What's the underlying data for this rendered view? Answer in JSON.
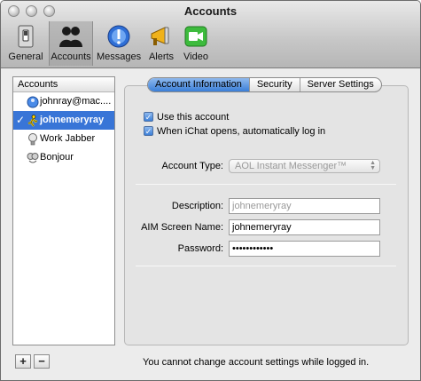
{
  "window": {
    "title": "Accounts"
  },
  "toolbar": {
    "items": [
      {
        "label": "General",
        "icon": "general-switch-icon"
      },
      {
        "label": "Accounts",
        "icon": "accounts-people-icon",
        "selected": true
      },
      {
        "label": "Messages",
        "icon": "messages-info-icon"
      },
      {
        "label": "Alerts",
        "icon": "alerts-megaphone-icon"
      },
      {
        "label": "Video",
        "icon": "video-camera-icon"
      }
    ]
  },
  "sidebar": {
    "header": "Accounts",
    "accounts": [
      {
        "label": "johnray@mac....",
        "icon": "dotmac-icon",
        "selected": false
      },
      {
        "label": "johnemeryray",
        "icon": "aim-runner-icon",
        "selected": true,
        "check": "✓"
      },
      {
        "label": "Work Jabber",
        "icon": "jabber-bulb-icon",
        "selected": false
      },
      {
        "label": "Bonjour",
        "icon": "bonjour-icon",
        "selected": false
      }
    ],
    "add_label": "+",
    "remove_label": "−"
  },
  "tabs": [
    {
      "label": "Account Information",
      "active": true
    },
    {
      "label": "Security",
      "active": false
    },
    {
      "label": "Server Settings",
      "active": false
    }
  ],
  "account_info": {
    "use_account": {
      "label": "Use this account",
      "checked": true
    },
    "auto_login": {
      "label": "When iChat opens, automatically log in",
      "checked": true
    },
    "account_type_label": "Account Type:",
    "account_type_value": "AOL Instant Messenger™",
    "description_label": "Description:",
    "description_value": "johnemeryray",
    "screen_name_label": "AIM Screen Name:",
    "screen_name_value": "johnemeryray",
    "password_label": "Password:",
    "password_value": "••••••••••••"
  },
  "status_message": "You cannot change account settings while logged in.",
  "colors": {
    "selection": "#3875d7",
    "tab_active": "#3b7fd8"
  }
}
